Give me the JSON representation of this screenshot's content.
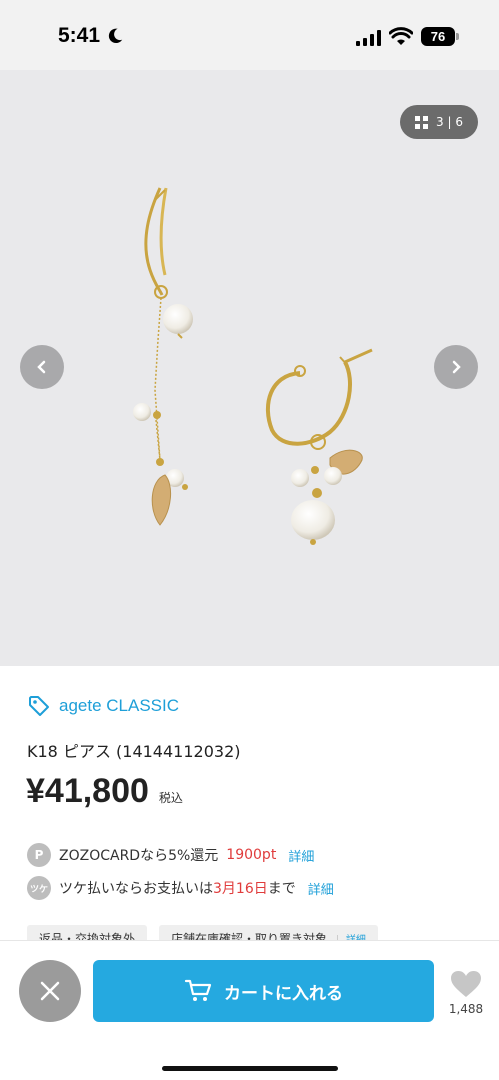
{
  "status_bar": {
    "time": "5:41",
    "battery": "76"
  },
  "gallery": {
    "counter": "3 | 6",
    "prev_icon": "chevron-left-icon",
    "next_icon": "chevron-right-icon"
  },
  "product": {
    "brand": "agete CLASSIC",
    "title": "K18 ピアス (14144112032)",
    "price": "¥41,800",
    "tax_label": "税込"
  },
  "points": {
    "row1": {
      "icon_text": "P",
      "prefix": "ZOZOCARDなら5%還元 ",
      "highlight": "1900pt",
      "link": "詳細"
    },
    "row2": {
      "icon_text": "ツケ",
      "prefix": "ツケ払いならお支払いは",
      "highlight": "3月16日",
      "suffix": "まで",
      "link": "詳細"
    }
  },
  "chips": [
    {
      "label": "返品・交換対象外"
    },
    {
      "label": "店舗在庫確認・取り置き対象",
      "link": "詳細"
    }
  ],
  "bottom_bar": {
    "cart_label": "カートに入れる",
    "favorite_count": "1,488"
  },
  "colors": {
    "accent": "#25a9e0",
    "brand_link": "#1e9fd8",
    "highlight_red": "#e03c3c"
  }
}
